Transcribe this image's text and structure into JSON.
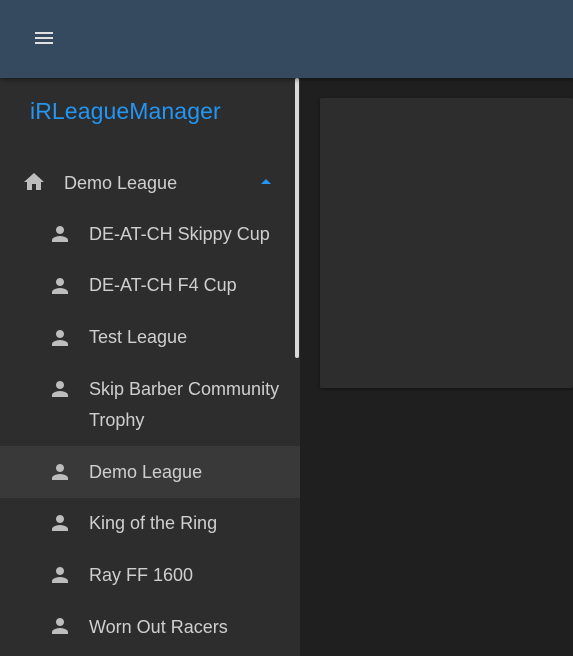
{
  "app": {
    "brand": "iRLeagueManager",
    "brand_color": "#2196f3",
    "appbar_color": "#35495f"
  },
  "appbar": {
    "menu_icon": "menu-icon"
  },
  "sidebar": {
    "group": {
      "icon": "home-icon",
      "label": "Demo League",
      "expanded": true,
      "caret_icon": "caret-up-icon"
    },
    "items": [
      {
        "label": "DE-AT-CH Skippy Cup",
        "icon": "person-icon",
        "active": false
      },
      {
        "label": "DE-AT-CH F4 Cup",
        "icon": "person-icon",
        "active": false
      },
      {
        "label": "Test League",
        "icon": "person-icon",
        "active": false
      },
      {
        "label": "Skip Barber Community Trophy",
        "icon": "person-icon",
        "active": false
      },
      {
        "label": "Demo League",
        "icon": "person-icon",
        "active": true
      },
      {
        "label": "King of the Ring",
        "icon": "person-icon",
        "active": false
      },
      {
        "label": "Ray FF 1600",
        "icon": "person-icon",
        "active": false
      },
      {
        "label": "Worn Out Racers",
        "icon": "person-icon",
        "active": false
      }
    ]
  }
}
